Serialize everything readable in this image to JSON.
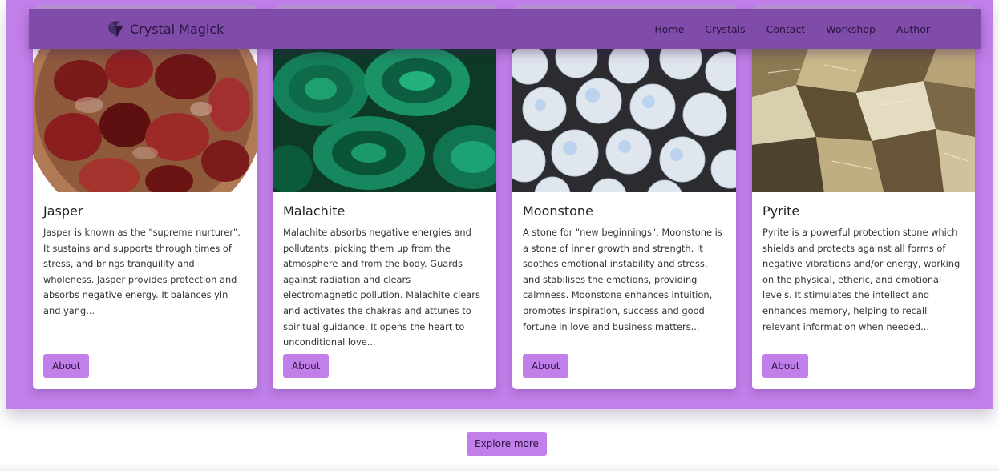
{
  "nav": {
    "brand": "Crystal Magick",
    "links": [
      "Home",
      "Crystals",
      "Contact",
      "Workshop",
      "Author"
    ]
  },
  "cards": [
    {
      "title": "Jasper",
      "text": "Jasper is known as the \"supreme nurturer\". It sustains and supports through times of stress, and brings tranquility and wholeness. Jasper provides protection and absorbs negative energy. It balances yin and yang...",
      "button": "About"
    },
    {
      "title": "Malachite",
      "text": "Malachite absorbs negative energies and pollutants, picking them up from the atmosphere and from the body. Guards against radiation and clears electromagnetic pollution. Malachite clears and activates the chakras and attunes to spiritual guidance. It opens the heart to unconditional love...",
      "button": "About"
    },
    {
      "title": "Moonstone",
      "text": "A stone for \"new beginnings\", Moonstone is a stone of inner growth and strength. It soothes emotional instability and stress, and stabilises the emotions, providing calmness. Moonstone enhances intuition, promotes inspiration, success and good fortune in love and business matters...",
      "button": "About"
    },
    {
      "title": "Pyrite",
      "text": "Pyrite is a powerful protection stone which shields and protects against all forms of negative vibrations and/or energy, working on the physical, etheric, and emotional levels. It stimulates the intellect and enhances memory, helping to recall relevant information when needed...",
      "button": "About"
    }
  ],
  "explore_button": "Explore more",
  "colors": {
    "band": "#c07fe9",
    "nav": "#7f4ca9",
    "button": "#c07fe9"
  },
  "icons": {
    "brand": "crystal-logo-icon"
  }
}
